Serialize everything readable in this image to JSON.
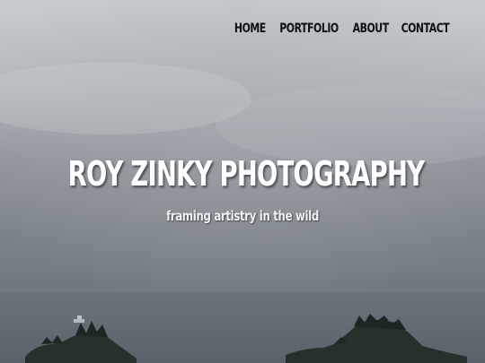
{
  "nav": {
    "items": [
      {
        "label": "HOME"
      },
      {
        "label": "PORTFOLIO"
      },
      {
        "label": "ABOUT"
      },
      {
        "label": "CONTACT"
      }
    ]
  },
  "hero": {
    "title": "ROY ZINKY PHOTOGRAPHY",
    "tagline": "framing artistry in the wild",
    "image": "foggy-sea-islands-photo"
  },
  "colors": {
    "nav_text": "#0f1114",
    "title_text": "#ffffff",
    "sky_top": "#c9cdd2",
    "sky_mid": "#9a9fa5",
    "water": "#5e666d",
    "island": "#1f2a25"
  }
}
